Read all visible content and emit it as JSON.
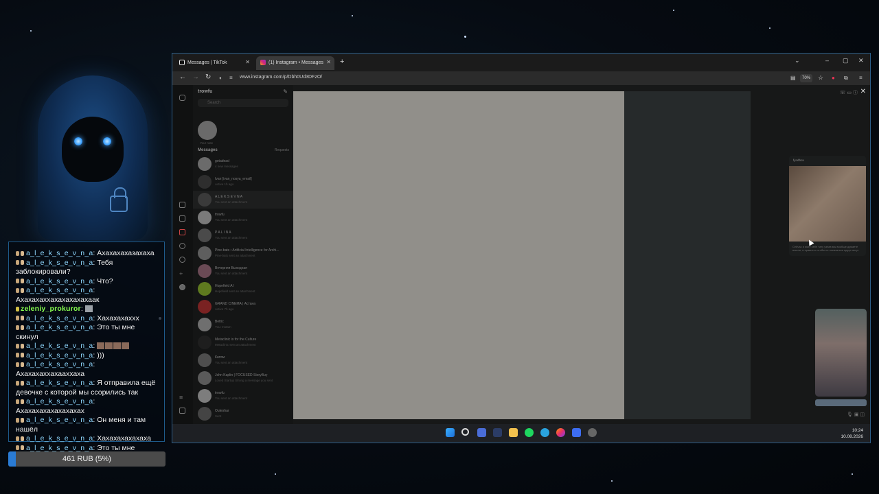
{
  "chat": {
    "messages": [
      {
        "user": "a_l_e_k_s_e_v_n_a",
        "text": "Ахахахахазахаха"
      },
      {
        "user": "a_l_e_k_s_e_v_n_a",
        "text": "Тебя заблокировали?"
      },
      {
        "user": "a_l_e_k_s_e_v_n_a",
        "text": "Что?"
      },
      {
        "user": "a_l_e_k_s_e_v_n_a",
        "text": "Ахахахаххахахахахахаак"
      },
      {
        "user": "zeleniy_prokuror",
        "text": ""
      },
      {
        "user": "a_l_e_k_s_e_v_n_a",
        "text": "Хахахахаххх"
      },
      {
        "user": "a_l_e_k_s_e_v_n_a",
        "text": "Это ты мне скинул"
      },
      {
        "user": "a_l_e_k_s_e_v_n_a",
        "text": ""
      },
      {
        "user": "a_l_e_k_s_e_v_n_a",
        "text": ")))"
      },
      {
        "user": "a_l_e_k_s_e_v_n_a",
        "text": "Ахахахаххахааххаха"
      },
      {
        "user": "a_l_e_k_s_e_v_n_a",
        "text": "Я отправила ещё девочке с которой мы ссорились так"
      },
      {
        "user": "a_l_e_k_s_e_v_n_a",
        "text": "Ахахахахахахахахах"
      },
      {
        "user": "a_l_e_k_s_e_v_n_a",
        "text": "Он меня и там нашёл"
      },
      {
        "user": "a_l_e_k_s_e_v_n_a",
        "text": "Хахахахахахаха"
      },
      {
        "user": "a_l_e_k_s_e_v_n_a",
        "text": "Это ты мне скинул же?"
      }
    ]
  },
  "donation": {
    "label": "461 RUB (5%)",
    "progress": 0.05,
    "color": "#2a7bd4"
  },
  "browser": {
    "tabs": [
      {
        "label": "Messages | TikTok",
        "active": false
      },
      {
        "label": "(1) Instagram • Messages",
        "active": true
      }
    ],
    "new_tab": "+",
    "url": "www.instagram.com/p/Dbh0Ud3DFzO/",
    "zoom": "70%",
    "controls": {
      "minimize": "–",
      "maximize": "▢",
      "close": "✕",
      "dropdown": "⌄"
    }
  },
  "instagram": {
    "username": "trowfu",
    "search_placeholder": "Search",
    "note_label": "Your note",
    "messages_heading": "Messages",
    "requests_label": "Requests",
    "conversations": [
      {
        "name": "gotadead",
        "sub": "4 new messages"
      },
      {
        "name": "Ivan [ivan_nosya_email]",
        "sub": "Active 1h ago"
      },
      {
        "name": "A L E K S E V N A",
        "sub": "You sent an attachment"
      },
      {
        "name": "trowfu",
        "sub": "You sent an attachment"
      },
      {
        "name": "P A L I N A",
        "sub": "You sent an attachment"
      },
      {
        "name": "Pine-bats • Artificial Intelligence for Archi...",
        "sub": "Pine-bats sent an attachment"
      },
      {
        "name": "Вечерняя Выходная",
        "sub": "You sent an attachment"
      },
      {
        "name": "Hopefield AI",
        "sub": "Hopefield sent an attachment"
      },
      {
        "name": "GRAND CINEMA | Астана",
        "sub": "Active 7h ago"
      },
      {
        "name": "Betric",
        "sub": "You: Instam"
      },
      {
        "name": "Metaclinic is for the Culture",
        "sub": "Metaclinic sent an attachment"
      },
      {
        "name": "Катям",
        "sub": "You sent an attachment"
      },
      {
        "name": "John Kaplin | FOCUSED StoryBuy",
        "sub": "Loved Startup Strong a message you sent"
      },
      {
        "name": "trowfu",
        "sub": "You sent an attachment"
      },
      {
        "name": "Outeshar",
        "sub": "Sent"
      }
    ],
    "shared_card": {
      "author": "fyodbox",
      "caption": "Сейчас я могу себе тату узнав мы вообще думаете вошли, и нравится чтобы не показаться вдруг могут"
    }
  },
  "taskbar": {
    "time": "10:24",
    "date": "10.08.2026"
  }
}
